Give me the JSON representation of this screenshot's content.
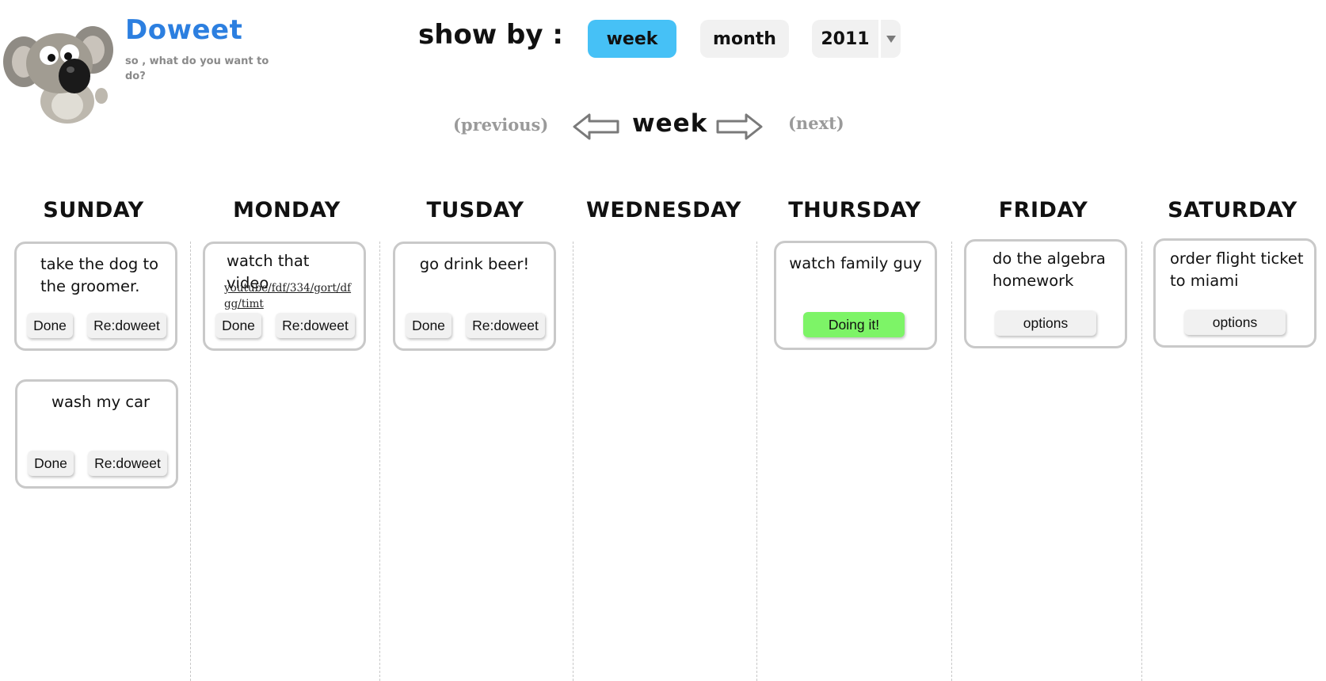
{
  "brand": {
    "name": "Doweet",
    "tagline": "so , what do you want to do?"
  },
  "show_by": {
    "label": "show by :",
    "options": [
      "week",
      "month"
    ],
    "active": "week",
    "year": "2011"
  },
  "navigation": {
    "previous": "(previous)",
    "current": "week",
    "next": "(next)"
  },
  "days": [
    {
      "name": "SUNDAY",
      "tasks": [
        {
          "text": "take the dog to the groomer.",
          "actions": [
            "Done",
            "Re:doweet"
          ]
        },
        {
          "text": "wash my car",
          "actions": [
            "Done",
            "Re:doweet"
          ]
        }
      ]
    },
    {
      "name": "MONDAY",
      "tasks": [
        {
          "text": "watch that video",
          "link": "youtube/fdf/334/gort/dfgg/timt",
          "actions": [
            "Done",
            "Re:doweet"
          ]
        }
      ]
    },
    {
      "name": "TUSDAY",
      "tasks": [
        {
          "text": "go drink beer!",
          "actions": [
            "Done",
            "Re:doweet"
          ]
        }
      ]
    },
    {
      "name": "WEDNESDAY",
      "tasks": []
    },
    {
      "name": "THURSDAY",
      "tasks": [
        {
          "text": "watch family guy",
          "actions": [
            "Doing it!"
          ]
        }
      ]
    },
    {
      "name": "FRIDAY",
      "tasks": [
        {
          "text": "do the algebra homework",
          "actions": [
            "options"
          ]
        }
      ]
    },
    {
      "name": "SATURDAY",
      "tasks": [
        {
          "text": "order flight ticket to miami",
          "actions": [
            "options"
          ]
        }
      ]
    }
  ],
  "colors": {
    "brand": "#2c7fe0",
    "active_pill": "#46c1f6",
    "doing_button": "#7df467",
    "card_border": "#c9c9c9"
  }
}
